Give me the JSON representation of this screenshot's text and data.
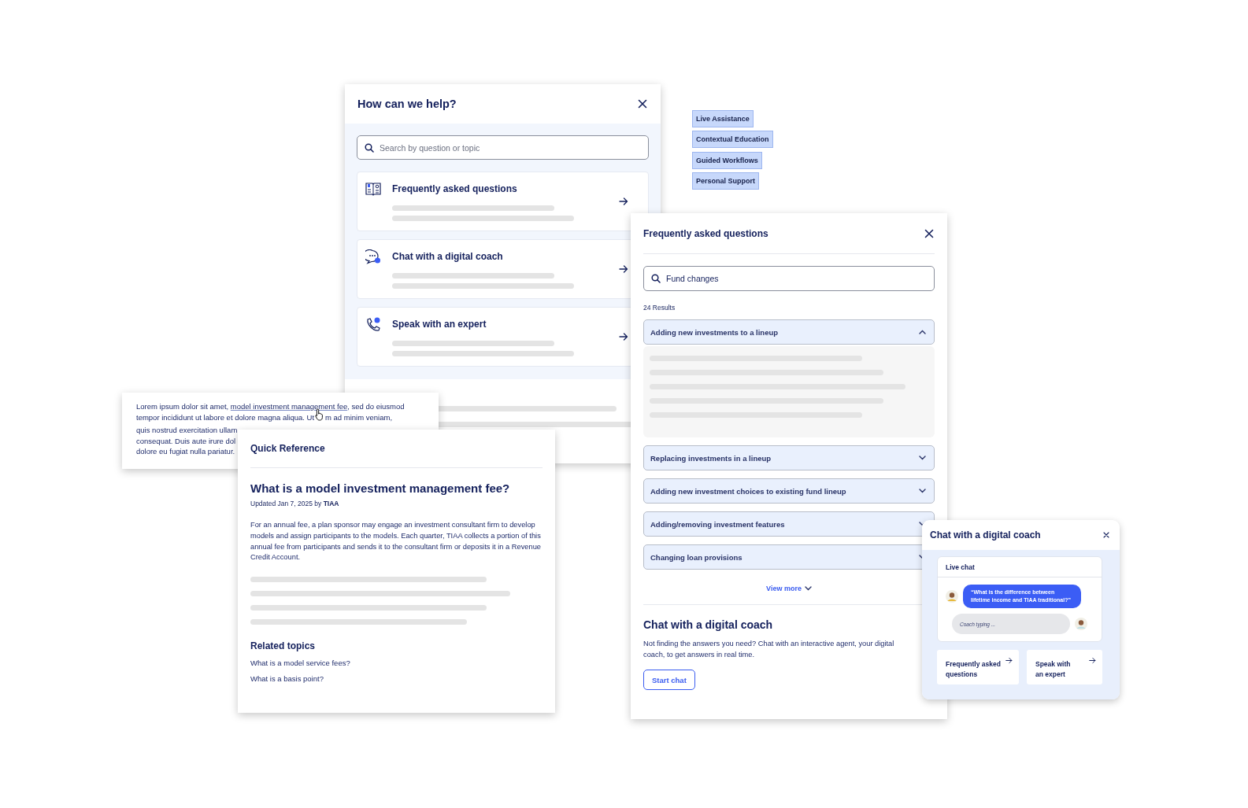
{
  "help_panel": {
    "title": "How can we help?",
    "search": {
      "placeholder": "Search by question or topic"
    },
    "options": [
      {
        "kind": "faq",
        "title": "Frequently asked questions"
      },
      {
        "kind": "chat",
        "title": "Chat with a digital coach"
      },
      {
        "kind": "expert",
        "title": "Speak with an expert"
      }
    ]
  },
  "tags": [
    "Live Assistance",
    "Contextual Education",
    "Guided Workflows",
    "Personal Support"
  ],
  "article_snippet": {
    "link_line": {
      "before": "Lorem ipsum dolor sit amet, ",
      "link": "model investment management fee",
      "after": ", sed do eiusmod"
    },
    "cursor_line": {
      "before": "tempor incididunt ut labore et dolore magna aliqua. Ut",
      "after": "m ad minim veniam,"
    },
    "lines": [
      "quis nostrud exercitation ullam",
      "consequat. Duis aute irure dol",
      "dolore eu fugiat nulla pariatur."
    ]
  },
  "quick_reference": {
    "title": "Quick Reference",
    "question": "What is a model investment management fee?",
    "updated": "Updated Jan 7, 2025 by **TIAA**",
    "body": "For an annual fee, a plan sponsor may engage an investment consultant firm to develop models and assign participants to the models. Each quarter, TIAA collects a portion of this annual fee from participants and sends it to the consultant firm or deposits it in a Revenue Credit Account.",
    "related_title": "Related topics",
    "related": [
      "What is a model service fees?",
      "What is a basis point?"
    ]
  },
  "faq_panel": {
    "title": "Frequently asked questions",
    "search": {
      "value": "Fund changes"
    },
    "results": "24 Results",
    "items": [
      {
        "title": "Adding new investments to a lineup",
        "expanded": true
      },
      {
        "title": "Replacing investments in a lineup",
        "expanded": false
      },
      {
        "title": "Adding new investment choices to existing fund lineup",
        "expanded": false
      },
      {
        "title": "Adding/removing investment features",
        "expanded": false
      },
      {
        "title": "Changing loan provisions",
        "expanded": false
      }
    ],
    "view_more": "View more",
    "chat_section": {
      "title": "Chat with a digital coach",
      "text": "Not finding the answers you need? Chat with an interactive agent, your digital coach, to get answers in real time.",
      "button": "Start chat"
    }
  },
  "chat_widget": {
    "title": "Chat with a digital coach",
    "live_chat": "Live chat",
    "user_message": "“What is the difference between lifetime income and TIAA traditional?”",
    "typing": "Coach typing ...",
    "links": [
      "Frequently asked questions",
      "Speak with an expert"
    ]
  }
}
